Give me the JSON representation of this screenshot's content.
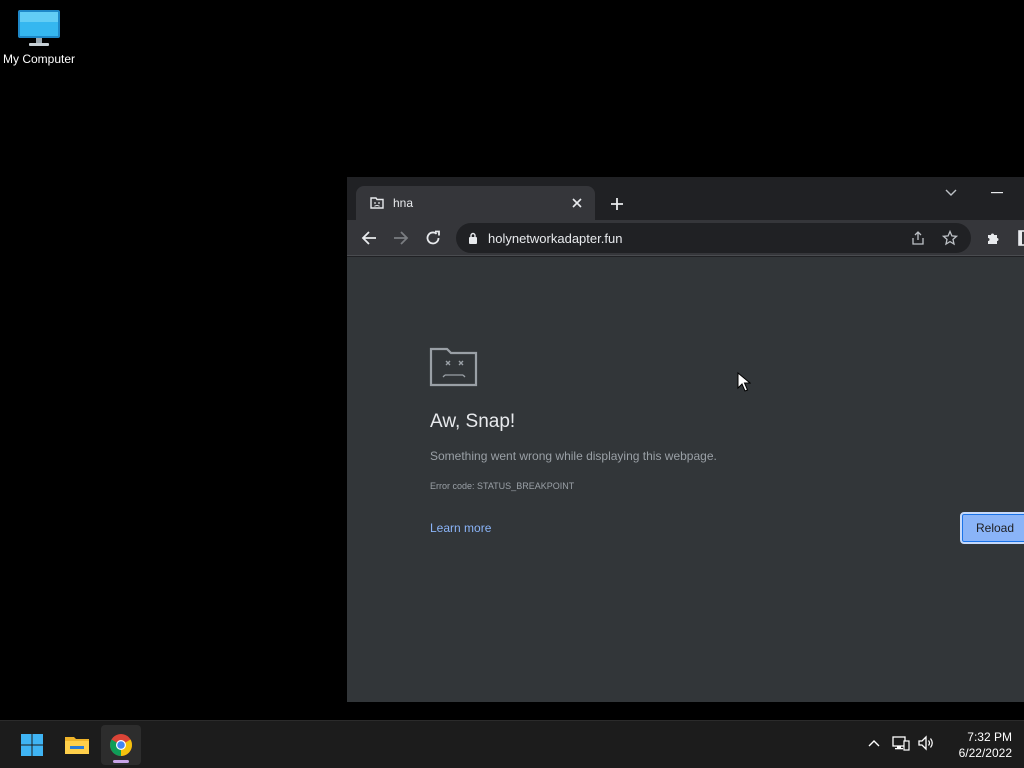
{
  "desktop": {
    "icons": [
      {
        "label": "My Computer",
        "icon": "monitor-icon"
      }
    ]
  },
  "browser": {
    "tab": {
      "title": "hna",
      "favicon": "sad-page-icon"
    },
    "omnibox": {
      "url": "holynetworkadapter.fun"
    }
  },
  "error_page": {
    "title": "Aw, Snap!",
    "message": "Something went wrong while displaying this webpage.",
    "error_code": "Error code: STATUS_BREAKPOINT",
    "learn_more": "Learn more",
    "reload": "Reload"
  },
  "taskbar": {
    "apps": [
      "start-icon",
      "file-explorer-icon",
      "chrome-icon"
    ],
    "active_app": "chrome-icon",
    "clock": {
      "time": "7:32 PM",
      "date": "6/22/2022"
    }
  },
  "colors": {
    "desktop_bg": "#000000",
    "page_bg": "#323639",
    "link": "#8ab4f8",
    "button": "#8ab4f8",
    "taskbar": "#1c1c1c"
  }
}
